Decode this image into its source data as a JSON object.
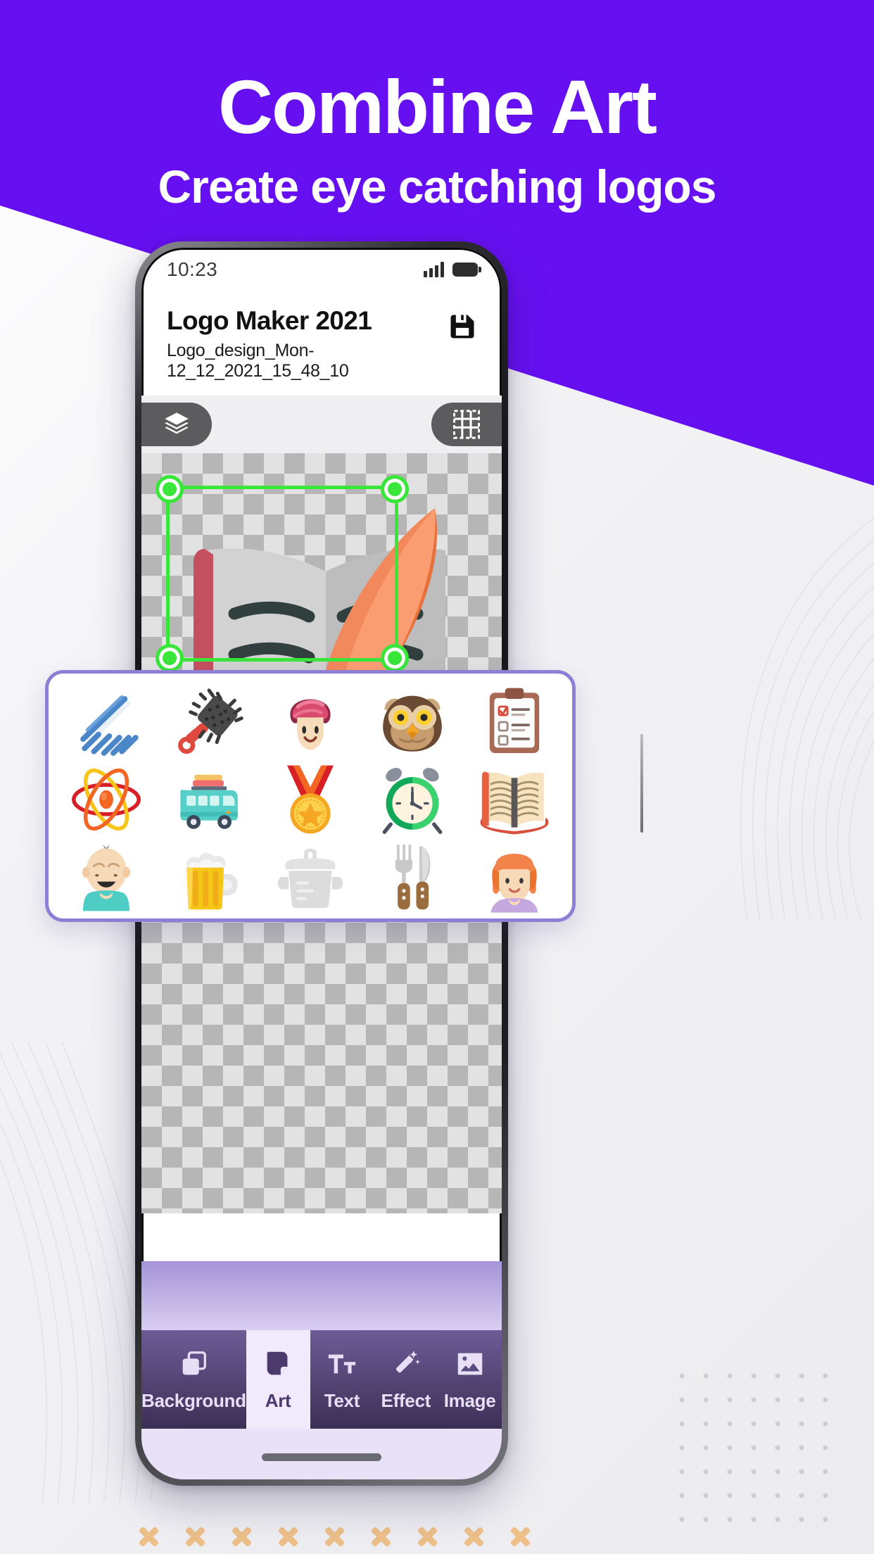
{
  "hero": {
    "title": "Combine Art",
    "subtitle": "Create eye catching logos",
    "bg_color": "#6610f2"
  },
  "phone": {
    "status": {
      "time": "10:23",
      "signal_icon": "signal-bars-icon",
      "battery_icon": "battery-icon"
    },
    "app_header": {
      "title": "Logo Maker 2021",
      "filename": "Logo_design_Mon-12_12_2021_15_48_10",
      "save_icon": "save-floppy-icon"
    },
    "toolbar": {
      "layers_icon": "layers-icon",
      "grid_icon": "grid-icon"
    },
    "canvas": {
      "artwork": "feather-quill-and-open-book",
      "selection_color": "#39e639",
      "checker_note": "transparency-checkerboard"
    },
    "bottom_nav": {
      "items": [
        {
          "label": "Background",
          "icon": "background-layers-icon",
          "active": false
        },
        {
          "label": "Art",
          "icon": "sticker-icon",
          "active": true
        },
        {
          "label": "Text",
          "icon": "text-size-icon",
          "active": false
        },
        {
          "label": "Effect",
          "icon": "magic-wand-icon",
          "active": false
        },
        {
          "label": "Image",
          "icon": "picture-icon",
          "active": false
        }
      ]
    }
  },
  "art_panel": {
    "border_color": "#8d7fd6",
    "items": [
      {
        "name": "comb-icon"
      },
      {
        "name": "hairbrush-icon"
      },
      {
        "name": "woman-with-towel-icon"
      },
      {
        "name": "owl-icon"
      },
      {
        "name": "clipboard-checklist-icon"
      },
      {
        "name": "atom-icon"
      },
      {
        "name": "minibus-icon"
      },
      {
        "name": "medal-icon"
      },
      {
        "name": "alarm-clock-icon"
      },
      {
        "name": "open-book-icon"
      },
      {
        "name": "baby-icon"
      },
      {
        "name": "beer-mug-icon"
      },
      {
        "name": "cooking-pot-icon"
      },
      {
        "name": "fork-and-knife-icon"
      },
      {
        "name": "girl-icon"
      }
    ]
  },
  "decor": {
    "x_marks_count": 9,
    "x_mark_color": "#edc08a",
    "dot_grid": "dot-grid-decoration",
    "swirls": "line-swirl-decoration"
  }
}
